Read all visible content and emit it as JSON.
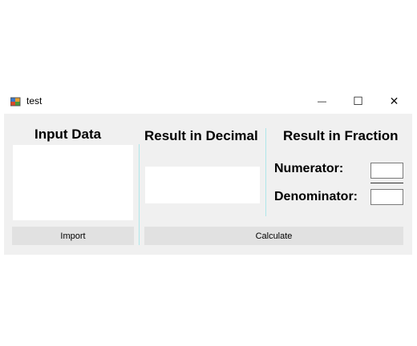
{
  "window": {
    "title": "test",
    "controls": {
      "minimize": "—",
      "maximize": "☐",
      "close": "✕"
    }
  },
  "input_panel": {
    "heading": "Input Data",
    "textbox_value": "",
    "import_label": "Import"
  },
  "decimal_panel": {
    "heading": "Result in Decimal",
    "result_value": ""
  },
  "fraction_panel": {
    "heading": "Result in Fraction",
    "numerator_label": "Numerator:",
    "denominator_label": "Denominator:",
    "numerator_value": "",
    "denominator_value": ""
  },
  "calculate_label": "Calculate",
  "icons": [
    "app-icon",
    "minimize-icon",
    "maximize-icon",
    "close-icon"
  ]
}
